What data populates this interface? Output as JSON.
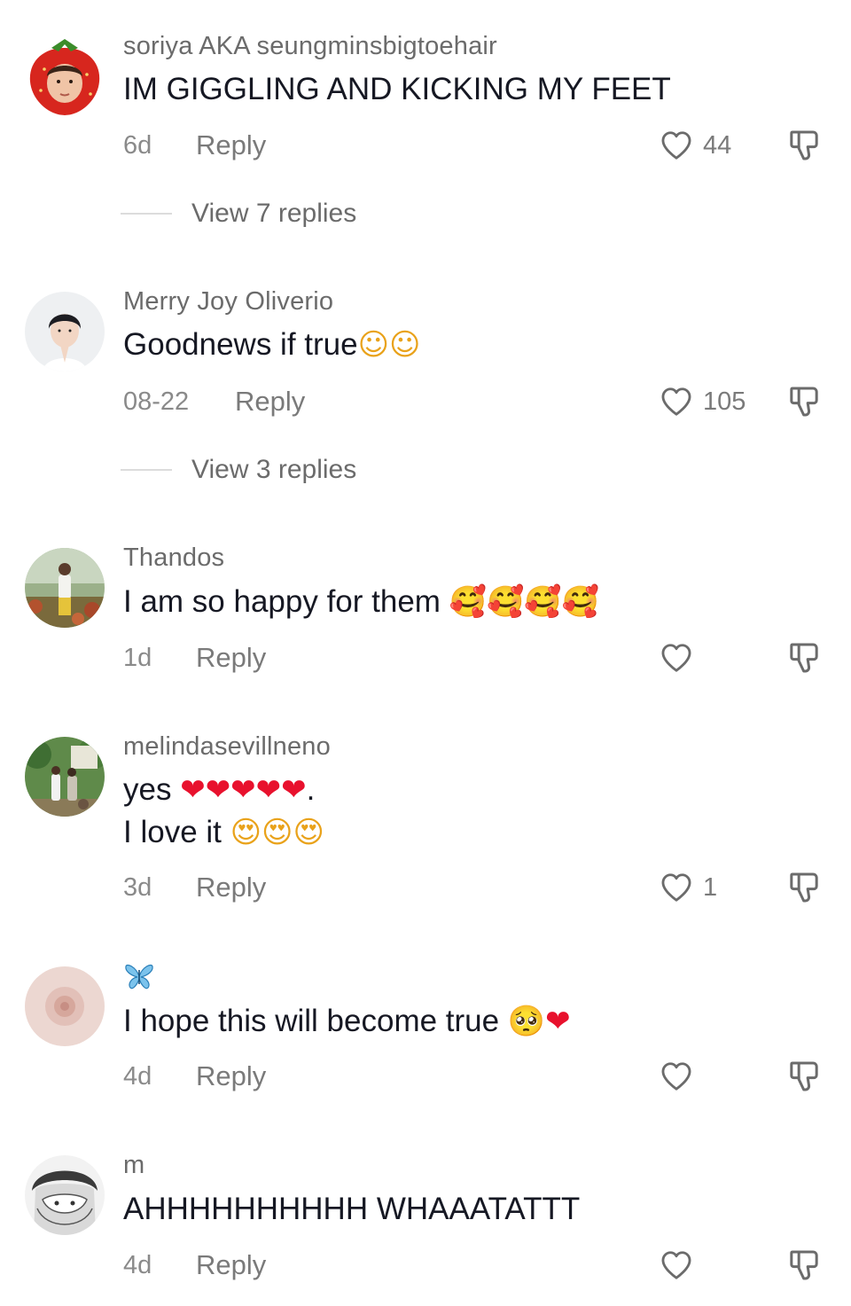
{
  "comments": [
    {
      "username": "soriya AKA seungminsbigtoehair",
      "text": "IM GIGGLING AND KICKING MY FEET",
      "emoji": "",
      "date": "6d",
      "reply_label": "Reply",
      "likes": "44",
      "view_replies": "View 7 replies"
    },
    {
      "username": "Merry Joy Oliverio",
      "text": "Goodnews if true",
      "emoji": "☺☺",
      "date": "08-22",
      "reply_label": "Reply",
      "likes": "105",
      "view_replies": "View 3 replies"
    },
    {
      "username": "Thandos",
      "text": "I am so happy for them ",
      "emoji": "🥰🥰🥰🥰",
      "date": "1d",
      "reply_label": "Reply",
      "likes": ""
    },
    {
      "username": "melindasevillneno",
      "text_line1": "yes ",
      "emoji_line1": "❤❤❤❤❤",
      "text_line1_end": ".",
      "text_line2": "I love it ",
      "emoji_line2": "😍😍😍",
      "date": "3d",
      "reply_label": "Reply",
      "likes": "1"
    },
    {
      "username": "🦋",
      "text": "I hope this will become true ",
      "emoji": "🥺❤",
      "date": "4d",
      "reply_label": "Reply",
      "likes": ""
    },
    {
      "username": "m",
      "text": "AHHHHHHHHHH WHAAATATTT",
      "emoji": "",
      "date": "4d",
      "reply_label": "Reply",
      "likes": ""
    }
  ],
  "icons": {
    "like": "heart-outline-icon",
    "dislike": "thumbs-down-icon"
  },
  "colors": {
    "username": "#6b6b6b",
    "text": "#161823",
    "meta": "#7a7a7a",
    "heart_red": "#e8112d"
  }
}
